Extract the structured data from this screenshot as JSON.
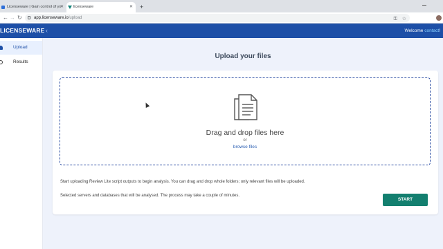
{
  "browser": {
    "tabs": [
      {
        "title": "Licenseware | Gain control of yo",
        "active": false
      },
      {
        "title": "licenseware",
        "active": true
      }
    ],
    "new_tab_icon": "plus-icon",
    "url_host": "app.licenseware.io",
    "url_path": "/upload"
  },
  "app": {
    "logo": "LICENSEWARE",
    "collapse_icon": "chevron-left-icon",
    "welcome_text": "Welcome ",
    "welcome_user": "contact",
    "welcome_suffix": "!",
    "brand_color": "#1d4fa7"
  },
  "sidebar": {
    "items": [
      {
        "label": "Upload",
        "icon": "upload-icon",
        "active": true
      },
      {
        "label": "Results",
        "icon": "gear-icon",
        "active": false
      }
    ]
  },
  "main": {
    "title": "Upload your files",
    "dropzone": {
      "icon": "document-icon",
      "title": "Drag and drop files here",
      "or_text": "or",
      "browse_link": "browse files"
    },
    "info_line_1": "Start uploading Review Lite script outputs to begin analysis. You can drag and drop whole folders; only relevant files will be uploaded.",
    "info_line_2": "Selected servers and databases that will be analysed. The process may take a couple of minutes.",
    "start_button": "START",
    "start_button_color": "#137f6f"
  }
}
